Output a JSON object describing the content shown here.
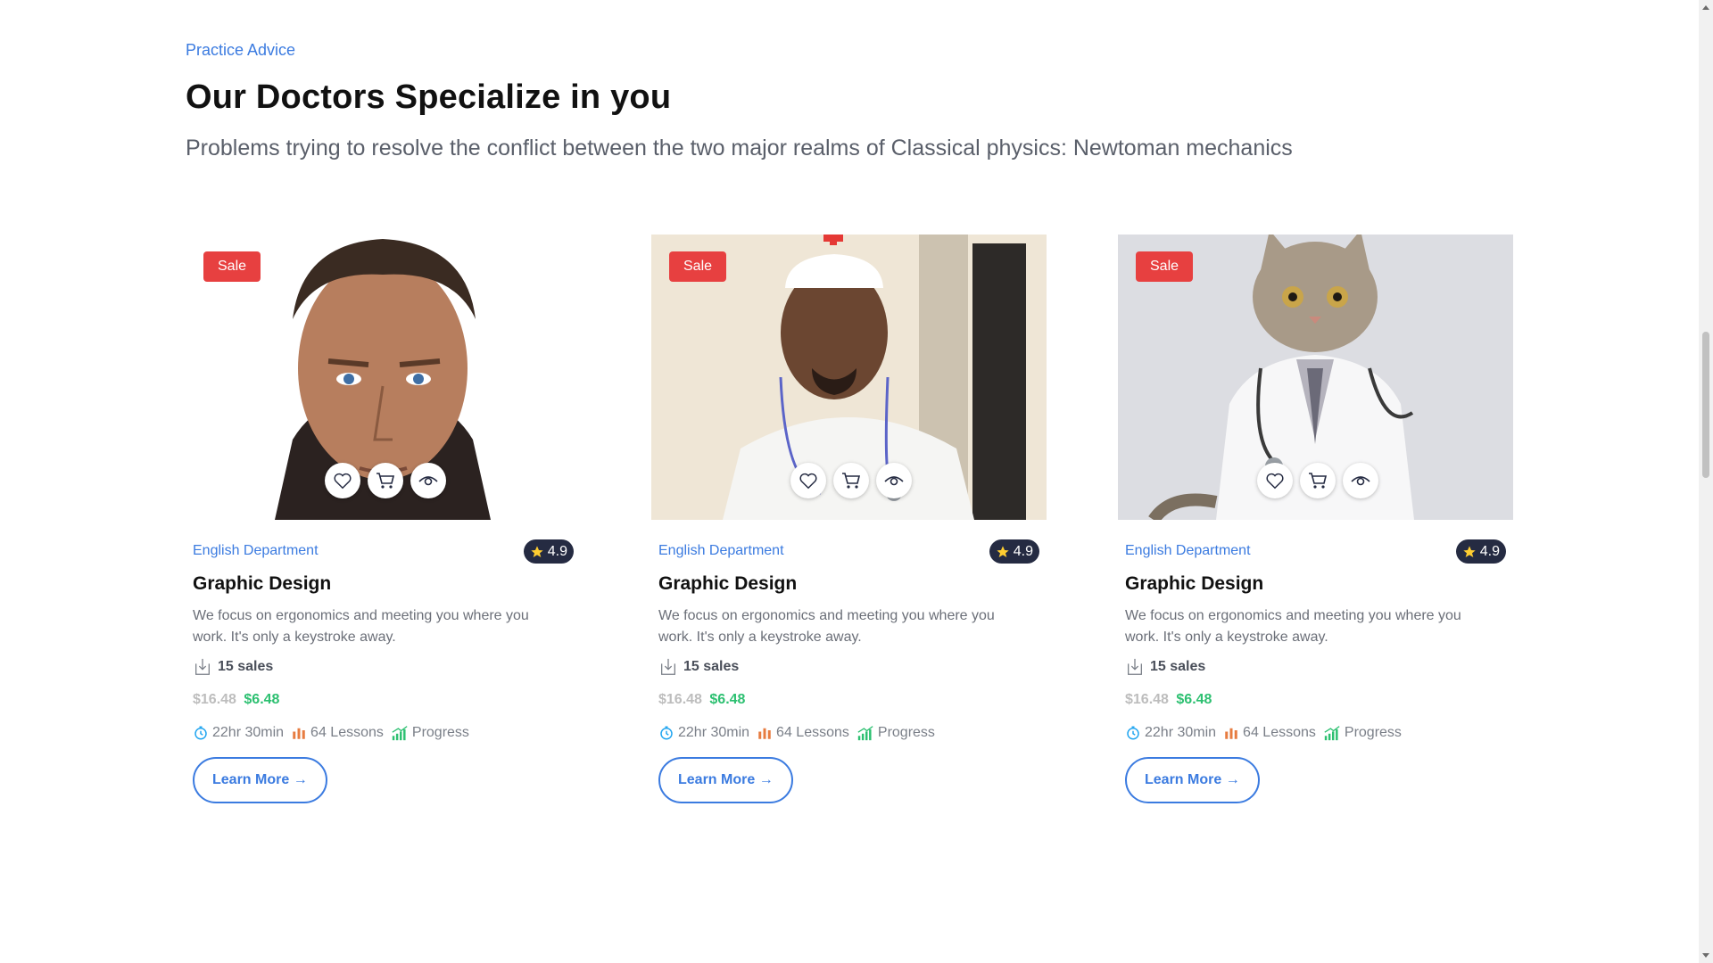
{
  "section": {
    "eyebrow": "Practice Advice",
    "title": "Our Doctors Specialize in you",
    "subtitle": "Problems trying to resolve the conflict between the two major realms of Classical physics: Newtoman mechanics"
  },
  "colors": {
    "accent": "#3b7be0",
    "sale": "#e74040",
    "price_new": "#2dc071",
    "price_old": "#bdbdbd",
    "rating_bg": "#252b42"
  },
  "cards": [
    {
      "image_icon": "doctor-portrait-icon",
      "badge": "Sale",
      "department": "English Department",
      "rating": "4.9",
      "title": "Graphic Design",
      "description": "We focus on ergonomics and meeting you where you work. It's only a keystroke away.",
      "sales": "15 sales",
      "old_price": "$16.48",
      "new_price": "$6.48",
      "duration": "22hr 30min",
      "lessons": "64 Lessons",
      "progress": "Progress",
      "cta": "Learn More →"
    },
    {
      "image_icon": "doctor-portrait-icon",
      "badge": "Sale",
      "department": "English Department",
      "rating": "4.9",
      "title": "Graphic Design",
      "description": "We focus on ergonomics and meeting you where you work. It's only a keystroke away.",
      "sales": "15 sales",
      "old_price": "$16.48",
      "new_price": "$6.48",
      "duration": "22hr 30min",
      "lessons": "64 Lessons",
      "progress": "Progress",
      "cta": "Learn More →"
    },
    {
      "image_icon": "cat-doctor-icon",
      "badge": "Sale",
      "department": "English Department",
      "rating": "4.9",
      "title": "Graphic Design",
      "description": "We focus on ergonomics and meeting you where you work. It's only a keystroke away.",
      "sales": "15 sales",
      "old_price": "$16.48",
      "new_price": "$6.48",
      "duration": "22hr 30min",
      "lessons": "64 Lessons",
      "progress": "Progress",
      "cta": "Learn More →"
    }
  ]
}
